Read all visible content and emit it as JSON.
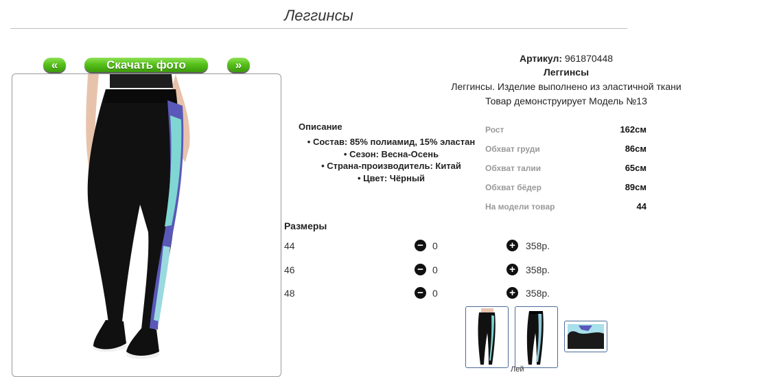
{
  "page": {
    "title": "Леггинсы"
  },
  "gallery": {
    "prev_label": "«",
    "download_label": "Скачать фото",
    "next_label": "»"
  },
  "product": {
    "article_label": "Артикул:",
    "article_value": "961870448",
    "name": "Леггинсы",
    "short_description": "Леггинсы. Изделие выполнено из эластичной ткани",
    "model_note": "Товар демонструирует Модель №13"
  },
  "description": {
    "title": "Описание",
    "items": [
      "• Состав: 85% полиамид, 15% эластан",
      "• Сезон: Весна-Осень",
      "• Страна-производитель: Китай",
      "• Цвет: Чёрный"
    ]
  },
  "measurements": [
    {
      "label": "Рост",
      "value": "162см"
    },
    {
      "label": "Обхват груди",
      "value": "86см"
    },
    {
      "label": "Обхват талии",
      "value": "65см"
    },
    {
      "label": "Обхват бёдер",
      "value": "89см"
    },
    {
      "label": "На модели товар",
      "value": "44"
    }
  ],
  "sizes": {
    "title": "Размеры",
    "rows": [
      {
        "size": "44",
        "qty": "0",
        "price": "358р."
      },
      {
        "size": "46",
        "qty": "0",
        "price": "358р."
      },
      {
        "size": "48",
        "qty": "0",
        "price": "358р."
      }
    ],
    "minus_symbol": "−",
    "plus_symbol": "+"
  },
  "footer_partial": "Лей",
  "colors": {
    "accent_green": "#56c21a",
    "thumb_border": "#4a6a9a",
    "stripe_blue": "#5a58b8",
    "stripe_cyan": "#7fd6d2"
  }
}
